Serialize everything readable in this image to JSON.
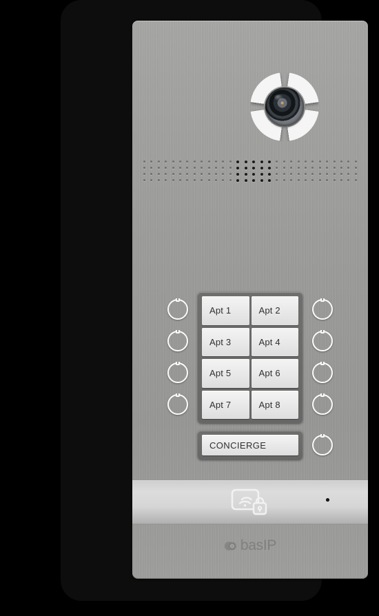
{
  "device": {
    "name": "bas-ip-multi-apartment-door-entry-panel",
    "brand_text": "basIP",
    "brand_mark_icon": "bas-ip-circle-logo-icon"
  },
  "camera": {
    "icon": "camera-lens-icon",
    "ring_icon": "camera-petal-ring-icon"
  },
  "speaker": {
    "icon": "speaker-grille-icon",
    "rows": 4,
    "columns": 30,
    "loud_center_columns": [
      13,
      14,
      15,
      16,
      17
    ]
  },
  "call_panel": {
    "buttons": [
      {
        "label": "Apt 1"
      },
      {
        "label": "Apt 2"
      },
      {
        "label": "Apt 3"
      },
      {
        "label": "Apt 4"
      },
      {
        "label": "Apt 5"
      },
      {
        "label": "Apt 6"
      },
      {
        "label": "Apt 7"
      },
      {
        "label": "Apt 8"
      }
    ]
  },
  "concierge": {
    "label": "CONCIERGE"
  },
  "selector_rings": {
    "icon": "call-selector-ring-icon",
    "left_count": 4,
    "right_count": 4,
    "concierge_ring_count": 1
  },
  "rfid": {
    "icon": "rfid-card-reader-lock-icon",
    "led_icon": "status-led-indicator-icon"
  },
  "colors": {
    "bezel": "#0d0d0d",
    "faceplate": "#9b9b99",
    "button_frame": "#6e6e6c",
    "button_face": "#eeeeee",
    "button_text": "#2f2f2f",
    "ring_stroke": "#fbfbfb",
    "rfid_band": "#d6d6d6",
    "led": "#1d1d1d"
  }
}
